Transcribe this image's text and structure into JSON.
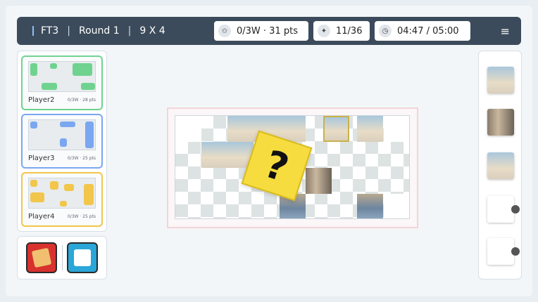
{
  "header": {
    "mode": "FT3",
    "sep": "|",
    "round": "Round 1",
    "grid": "9 X 4",
    "score_pill": "0/3W · 31 pts",
    "pieces_pill": "11/36",
    "timer_pill": "04:47 / 05:00",
    "menu_glyph": "≡"
  },
  "players": [
    {
      "name": "Player2",
      "score": "0/3W · 28 pts",
      "color": "#6fd38f"
    },
    {
      "name": "Player3",
      "score": "0/3W · 25 pts",
      "color": "#7aa7f0"
    },
    {
      "name": "Player4",
      "score": "0/3W · 25 pts",
      "color": "#f2c64a"
    }
  ],
  "mystery": {
    "glyph": "?"
  },
  "colors": {
    "accent": "#3c4b5b",
    "mystery": "#f6dc3e"
  },
  "icons": {
    "score": "star-icon",
    "pieces": "puzzle-icon",
    "timer": "clock-icon",
    "menu": "hamburger-icon"
  }
}
